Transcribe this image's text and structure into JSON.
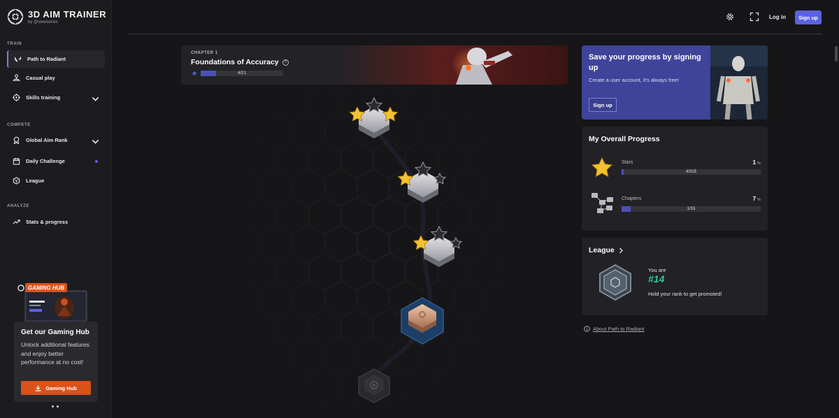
{
  "app": {
    "title": "3D AIM TRAINER",
    "subtitle": "by @steelseries"
  },
  "sidebar": {
    "sections": {
      "train": "TRAIN",
      "compete": "COMPETE",
      "analyze": "ANALYZE"
    },
    "items": [
      {
        "label": "Path to Radiant",
        "icon": "valorant-icon",
        "active": true
      },
      {
        "label": "Casual play",
        "icon": "joystick-icon"
      },
      {
        "label": "Skills training",
        "icon": "crosshair-icon",
        "expandable": true
      },
      {
        "label": "Global Aim Rank",
        "icon": "medal-icon",
        "expandable": true
      },
      {
        "label": "Daily Challenge",
        "icon": "calendar-icon",
        "badge": true
      },
      {
        "label": "League",
        "icon": "league-icon"
      },
      {
        "label": "Stats & progress",
        "icon": "trend-icon"
      }
    ]
  },
  "gaming_hub": {
    "badge": "GAMING HUB",
    "title": "Get our Gaming Hub",
    "text": "Unlock additional features and enjoy better performance at no cost!",
    "button": "Gaming Hub"
  },
  "header": {
    "login": "Log in",
    "signup": "Sign up",
    "icons": [
      "gear-icon",
      "fullscreen-icon"
    ]
  },
  "chapter": {
    "label": "CHAPTER 1",
    "title": "Foundations of Accuracy",
    "stars_earned": 4,
    "stars_total": 21,
    "count_text": "4/21"
  },
  "levels": [
    {
      "status": "completed",
      "stars": 2
    },
    {
      "status": "completed",
      "stars": 1
    },
    {
      "status": "completed",
      "stars": 1
    },
    {
      "status": "current",
      "stars": 0
    },
    {
      "status": "locked",
      "stars": 0
    }
  ],
  "save": {
    "title": "Save your progress by signing up",
    "text": "Create a user account, it's always free!",
    "button": "Sign up"
  },
  "progress": {
    "title": "My Overall Progress",
    "stars": {
      "label": "Stars",
      "percent": "1",
      "unit": "%",
      "count": "4/315",
      "fraction": 0.013
    },
    "chapters": {
      "label": "Chapters",
      "percent": "7",
      "unit": "%",
      "count": "1/15",
      "fraction": 0.067
    }
  },
  "league": {
    "title": "League",
    "you_are": "You are",
    "rank": "#14",
    "message": "Hold your rank to get promoted!"
  },
  "about_link": "About Path to Radiant",
  "colors": {
    "accent": "#5b62e0",
    "hub_orange": "#d9521a",
    "rank_teal": "#2fc7a3",
    "save_bg": "#3f449a"
  }
}
